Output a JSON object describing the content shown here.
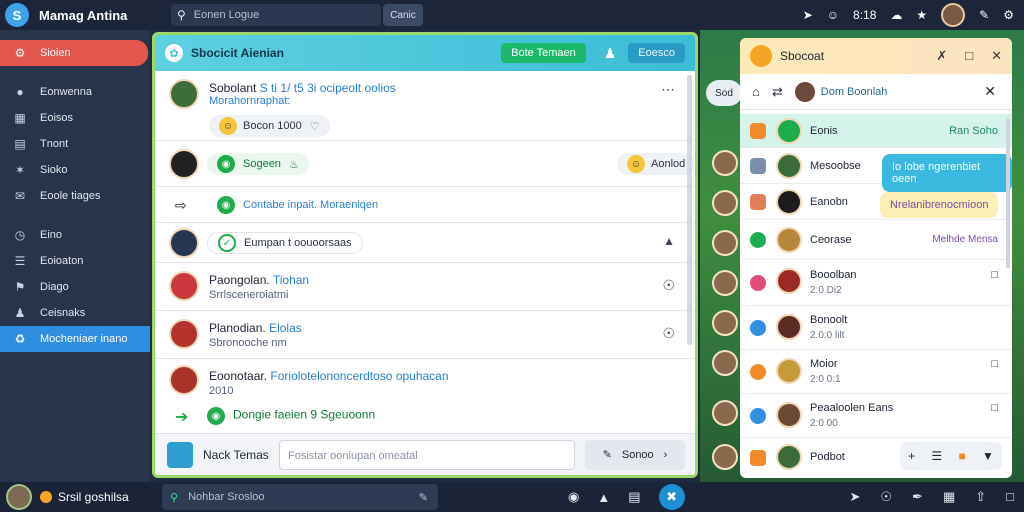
{
  "app": {
    "title": "Mamag Antina",
    "logo": "S"
  },
  "top": {
    "search_placeholder": "Eonen Logue",
    "search_button": "Canic",
    "clock": "8:18"
  },
  "sidebar": {
    "items": [
      {
        "label": "Sioien",
        "icon": "gear-icon"
      },
      {
        "label": "Eonwenna",
        "icon": "groups-icon"
      },
      {
        "label": "Eoisos",
        "icon": "grid-icon"
      },
      {
        "label": "Tnont",
        "icon": "document-icon"
      },
      {
        "label": "Sioko",
        "icon": "star-icon"
      },
      {
        "label": "Eoole tiages",
        "icon": "megaphone-icon"
      },
      {
        "label": "Eino",
        "icon": "clock-icon"
      },
      {
        "label": "Eoioaton",
        "icon": "list-icon"
      },
      {
        "label": "Diago",
        "icon": "chat-icon"
      },
      {
        "label": "Ceisnaks",
        "icon": "users-icon"
      },
      {
        "label": "Mocheniaer inano",
        "icon": "bell-icon"
      }
    ]
  },
  "chat": {
    "title": "Sbocicit Aienian",
    "header_button": "Bote Temaen",
    "header_button2": "Eoesco",
    "messages": [
      {
        "name": "Sobolant",
        "text": "S ti 1/ t5 3i ocipeolt oolios",
        "link": "Morahornraphat:",
        "reaction": "Bocon 1000",
        "reaction_icon": "heart-icon"
      },
      {
        "name": "Sogeen",
        "right": "Aonlod"
      },
      {
        "name": "Contabe inpait. Moraeniqen"
      },
      {
        "name": "Eumpan t oouoorsaas"
      },
      {
        "name": "Paongolan.",
        "link": "Tiohan",
        "sub": "Srrlsceneroiatmi"
      },
      {
        "name": "Planodian.",
        "link": "Elolas",
        "sub": "Sbronooche nm"
      },
      {
        "name": "Eoonotaar.",
        "text": "Foriolotelononcerdtoso opuhacan",
        "sub": "2010"
      },
      {
        "name": "Dongie faeien",
        "link": "9 Sgeuoonn"
      }
    ],
    "composer": {
      "label": "Nack Temas",
      "placeholder": "Fosistar ooniupan omeatal",
      "send": "Sonoo"
    }
  },
  "friends": {
    "title": "Sbocoat",
    "current_user": "Dom Boonlah",
    "rows": [
      {
        "name": "Eonis",
        "meta": "",
        "right": "Ran Soho"
      },
      {
        "name": "Mesoobse",
        "meta": "",
        "right": ""
      },
      {
        "name": "Eanobn",
        "meta": "",
        "right": ""
      },
      {
        "name": "Ceorase",
        "meta": "",
        "right": "Melhde Mensa"
      },
      {
        "name": "Booolban",
        "meta": "2:0 Di2",
        "right": ""
      },
      {
        "name": "Bonoolt",
        "meta": "2.0:0 lilt",
        "right": ""
      },
      {
        "name": "Moior",
        "meta": "2:0 0:1",
        "right": ""
      },
      {
        "name": "Peaaloolen",
        "meta": "2:0 00",
        "right": "Eans"
      },
      {
        "name": "Podbot",
        "meta": "",
        "right": ""
      }
    ],
    "tooltip1": "Io lobe ngerenbiet oeen",
    "tooltip2": "Nrelanibrenocmioon"
  },
  "taskbar": {
    "user": "Srsil goshilsa",
    "search_placeholder": "Nohbar Srosloo"
  },
  "colors": {
    "accent_red": "#e2574c",
    "accent_blue": "#2f8ee0",
    "accent_green": "#1db96a",
    "header_teal": "#3cbcd8"
  }
}
